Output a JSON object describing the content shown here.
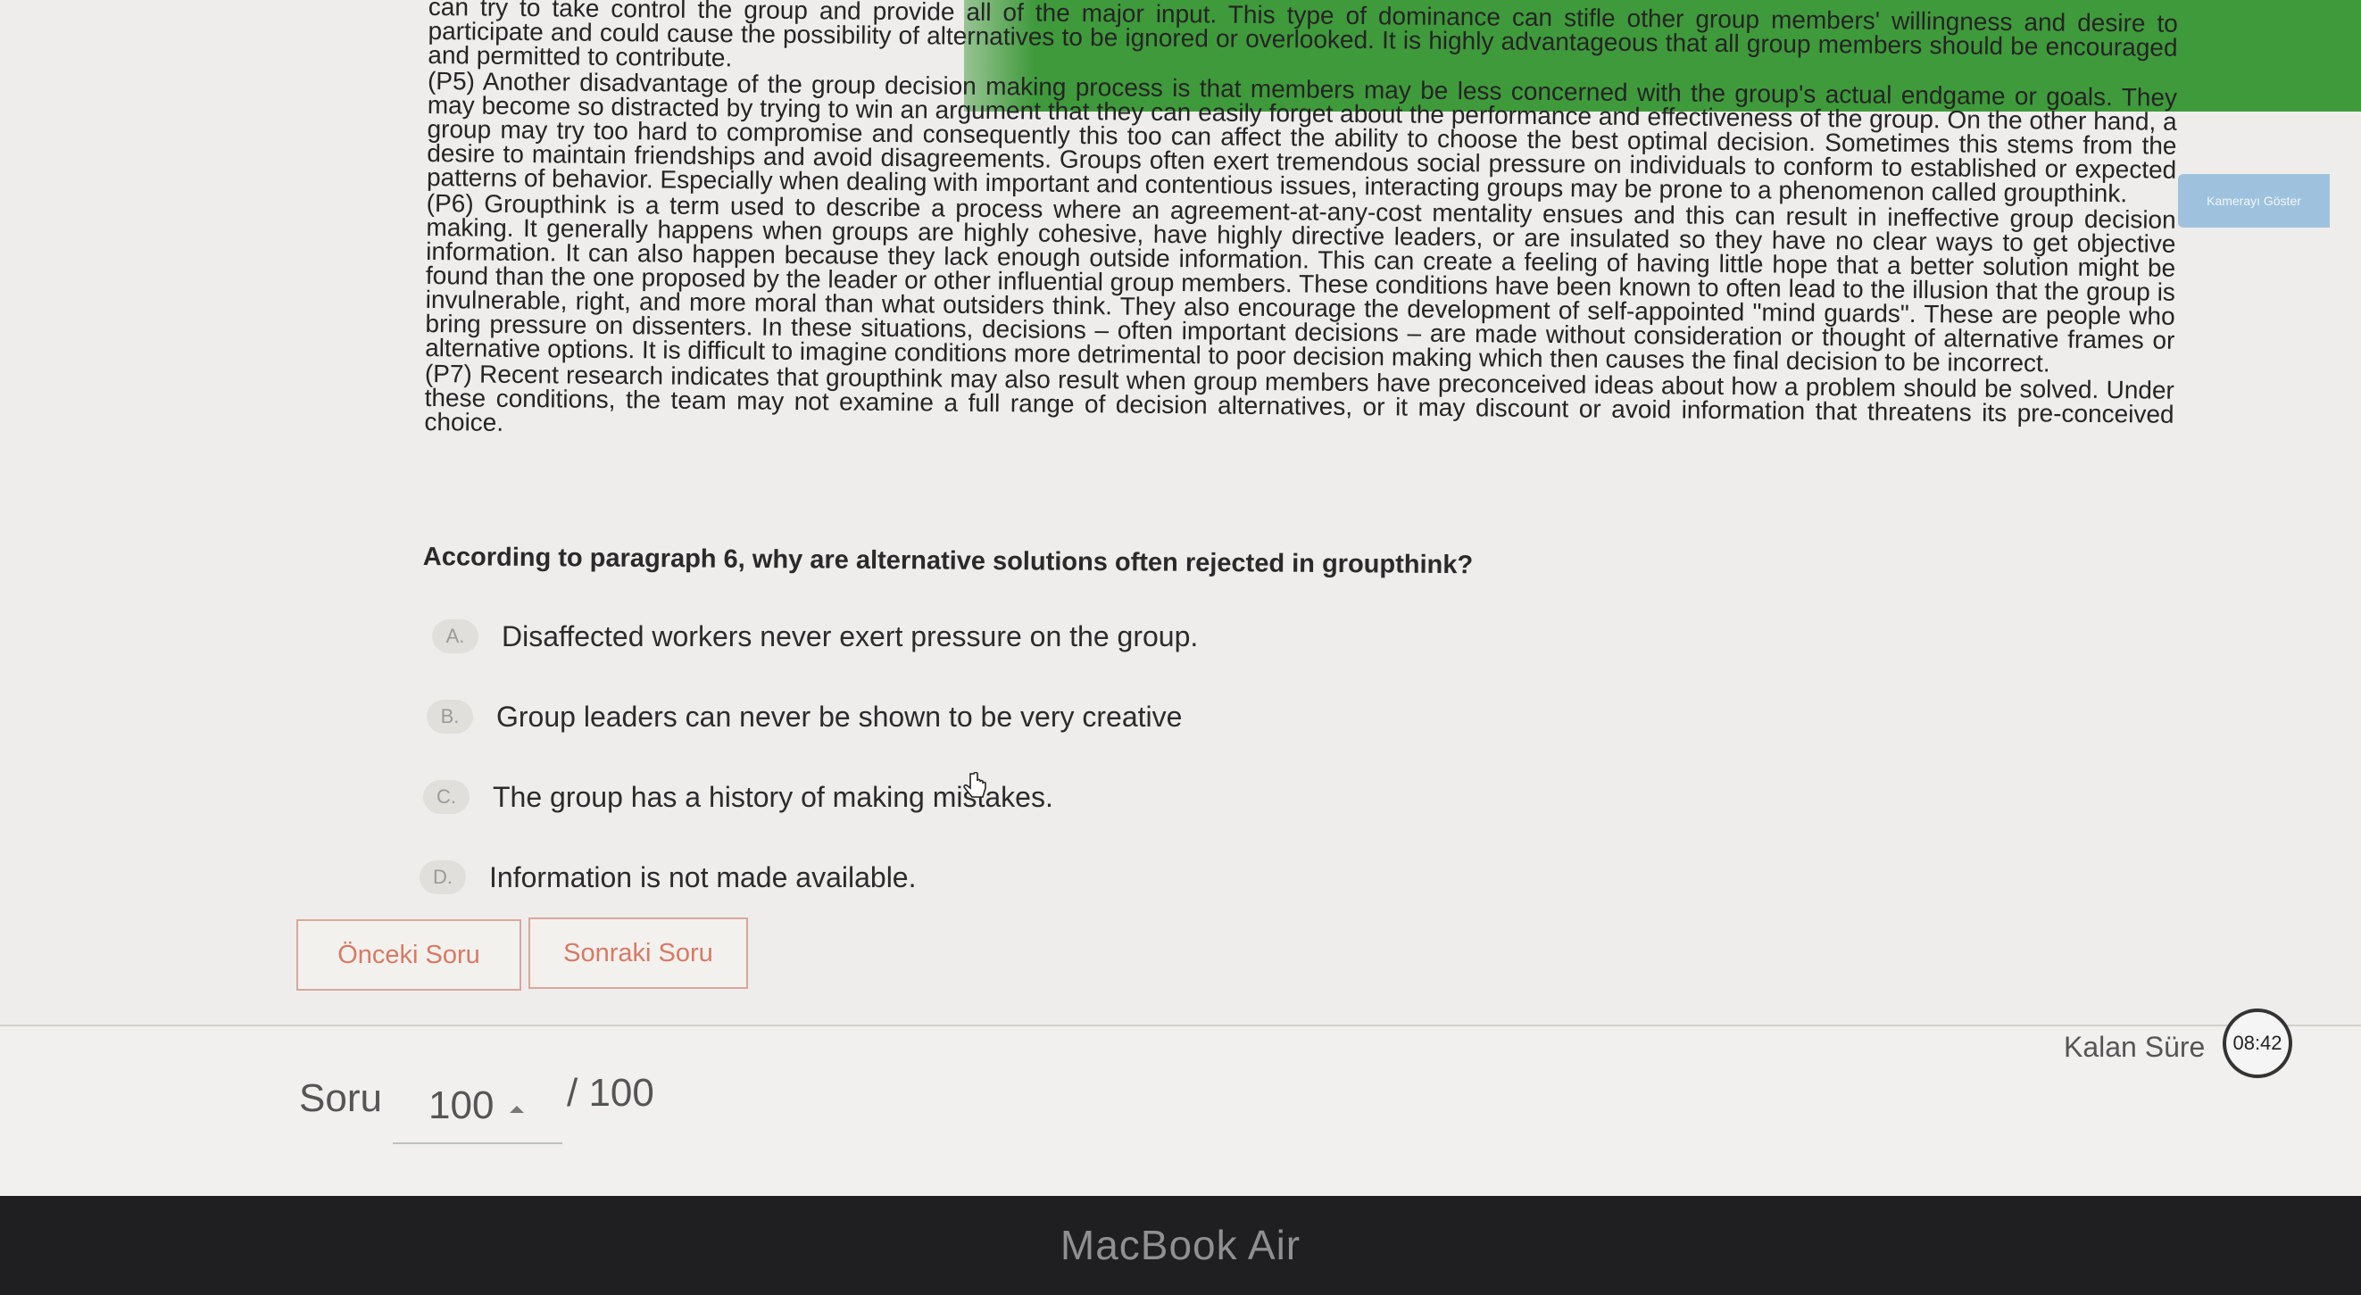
{
  "side_tab": "Kamerayı Göster",
  "passage": [
    {
      "lead": false,
      "text": "can try to take control the group and provide all of the major input. This type of dominance can stifle other group members' willingness and desire to participate and could cause the possibility of alternatives to be ignored or overlooked. It is highly advantageous that all group members should be encouraged and permitted to contribute."
    },
    {
      "lead": false,
      "text": "(P5) Another disadvantage of the group decision making process is that members may be less concerned with the group's actual endgame or goals. They may become so distracted by trying to win an argument that they can easily forget about the performance and effectiveness of the group. On the other hand, a group may try too hard to compromise and consequently this too can affect the ability to choose the best optimal decision. Sometimes this stems from the desire to maintain friendships and avoid disagreements. Groups often exert tremendous social pressure on individuals to conform to established or expected patterns of behavior. Especially when dealing with important and contentious issues, interacting groups may be prone to a phenomenon called groupthink."
    },
    {
      "lead": false,
      "text": "(P6) Groupthink is a term used to describe a process where an agreement-at-any-cost mentality ensues and this can result in ineffective group decision making. It generally happens when groups are highly cohesive, have highly directive leaders, or are insulated so they have no clear ways to get objective information. It can also happen because they lack enough outside information. This can create a feeling of having little hope that a better solution might be found than the one proposed by the leader or other influential group members. These conditions have been known to often lead to the illusion that the group is invulnerable, right, and more moral than what outsiders think. They also encourage the development of self-appointed \"mind guards\". These are people who bring pressure on dissenters. In these situations, decisions – often important decisions – are made without consideration or thought of alternative frames or alternative options. It is difficult to imagine conditions more detrimental to poor decision making which then causes the final decision to be incorrect."
    },
    {
      "lead": false,
      "text": "(P7) Recent research indicates that groupthink may also result when group members have preconceived ideas about how a problem should be solved. Under these conditions, the team may not examine a full range of decision alternatives, or it may discount or avoid information that threatens its pre-conceived choice."
    }
  ],
  "question": "According to paragraph 6, why are alternative solutions often rejected in groupthink?",
  "options": [
    {
      "letter": "A.",
      "text": "Disaffected workers never exert pressure on the group."
    },
    {
      "letter": "B.",
      "text": "Group leaders can never be shown to be very creative"
    },
    {
      "letter": "C.",
      "text": "The group has a history of making mistakes."
    },
    {
      "letter": "D.",
      "text": "Information is not made available."
    }
  ],
  "nav": {
    "prev_label": "Önceki Soru",
    "next_label": "Sonraki Soru"
  },
  "footer": {
    "soru_label": "Soru",
    "current": "100",
    "total": "/ 100",
    "timer_label": "Kalan Süre",
    "timer_value": "08:42"
  },
  "device_label": "MacBook Air",
  "colors": {
    "accent_button": "#d77a64",
    "green_band": "#3f9a3b"
  }
}
